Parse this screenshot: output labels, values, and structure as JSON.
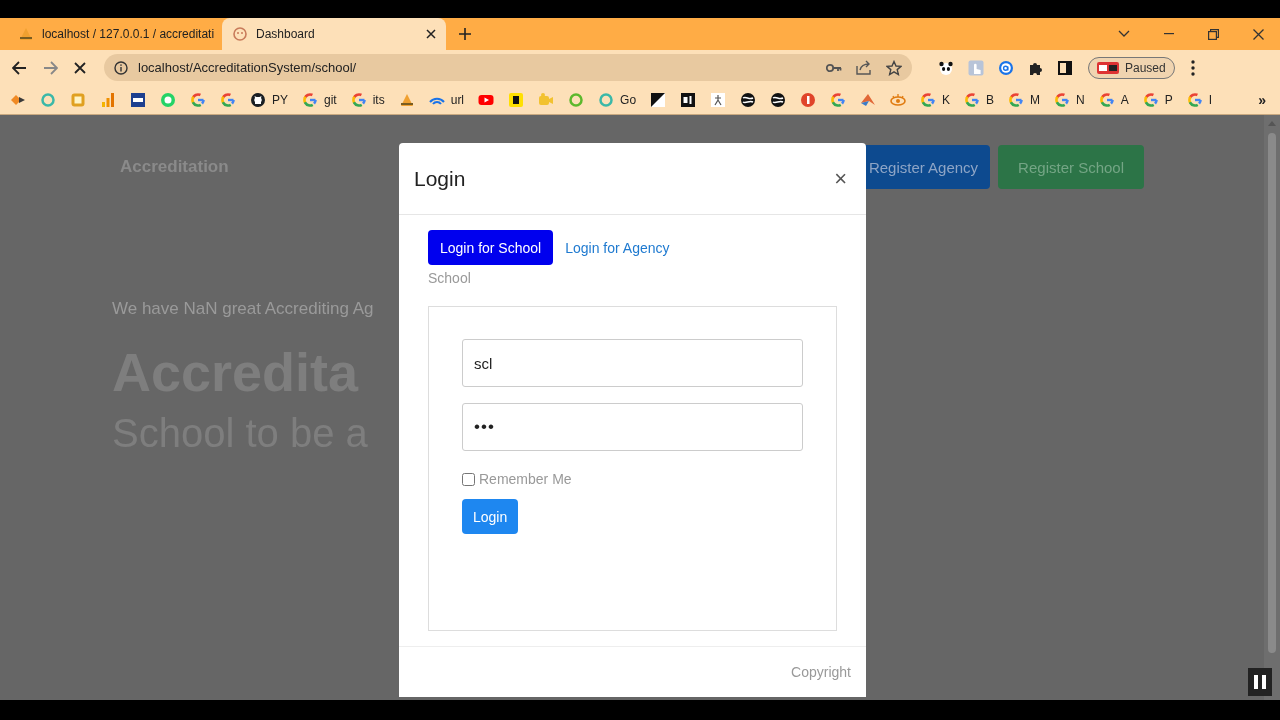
{
  "browser": {
    "tabs": [
      {
        "title": "localhost / 127.0.0.1 / accreditati",
        "kind": "pma",
        "selected": false
      },
      {
        "title": "Dashboard",
        "kind": "face",
        "selected": true
      }
    ],
    "address": "localhost/AccreditationSystem/school/",
    "profile": "Paused",
    "bookmarks": [
      {
        "kind": "diamond"
      },
      {
        "kind": "ring-teal"
      },
      {
        "kind": "tile-yellow"
      },
      {
        "kind": "bars"
      },
      {
        "kind": "tile-blue"
      },
      {
        "kind": "chat-green"
      },
      {
        "kind": "google"
      },
      {
        "kind": "google"
      },
      {
        "kind": "github",
        "label": "PY"
      },
      {
        "kind": "google",
        "label": "git"
      },
      {
        "kind": "google",
        "label": "its"
      },
      {
        "kind": "pma"
      },
      {
        "kind": "wifi",
        "label": "url"
      },
      {
        "kind": "play-red"
      },
      {
        "kind": "tile-dark"
      },
      {
        "kind": "camera"
      },
      {
        "kind": "ring-lime"
      },
      {
        "kind": "ring-teal",
        "label": "Go"
      },
      {
        "kind": "tile-mixed"
      },
      {
        "kind": "tile-black"
      },
      {
        "kind": "tile-white"
      },
      {
        "kind": "globe"
      },
      {
        "kind": "globe"
      },
      {
        "kind": "circle-red"
      },
      {
        "kind": "google"
      },
      {
        "kind": "matlab"
      },
      {
        "kind": "eye"
      },
      {
        "kind": "google",
        "label": "K"
      },
      {
        "kind": "google",
        "label": "B"
      },
      {
        "kind": "google",
        "label": "M"
      },
      {
        "kind": "google",
        "label": "N"
      },
      {
        "kind": "google",
        "label": "A"
      },
      {
        "kind": "google",
        "label": "P"
      },
      {
        "kind": "google",
        "label": "I"
      }
    ],
    "bookmarks_overflow": "»"
  },
  "page": {
    "brand": "Accreditation",
    "nav_buttons": [
      {
        "label": "Register Agency",
        "kind": "primary"
      },
      {
        "label": "Register School",
        "kind": "success"
      }
    ],
    "hero": {
      "subtitle": "We have NaN great Accrediting Ag",
      "title": "Accredita",
      "tagline": "School to be a"
    }
  },
  "modal": {
    "title": "Login",
    "close": "×",
    "tabs": [
      {
        "label": "Login for School",
        "selected": true
      },
      {
        "label": "Login for Agency",
        "selected": false
      }
    ],
    "section": "School",
    "username": {
      "value": "scl"
    },
    "password": {
      "value": "•••"
    },
    "remember": {
      "label": "Remember Me",
      "checked": false
    },
    "submit": "Login",
    "footer": "Copyright"
  }
}
